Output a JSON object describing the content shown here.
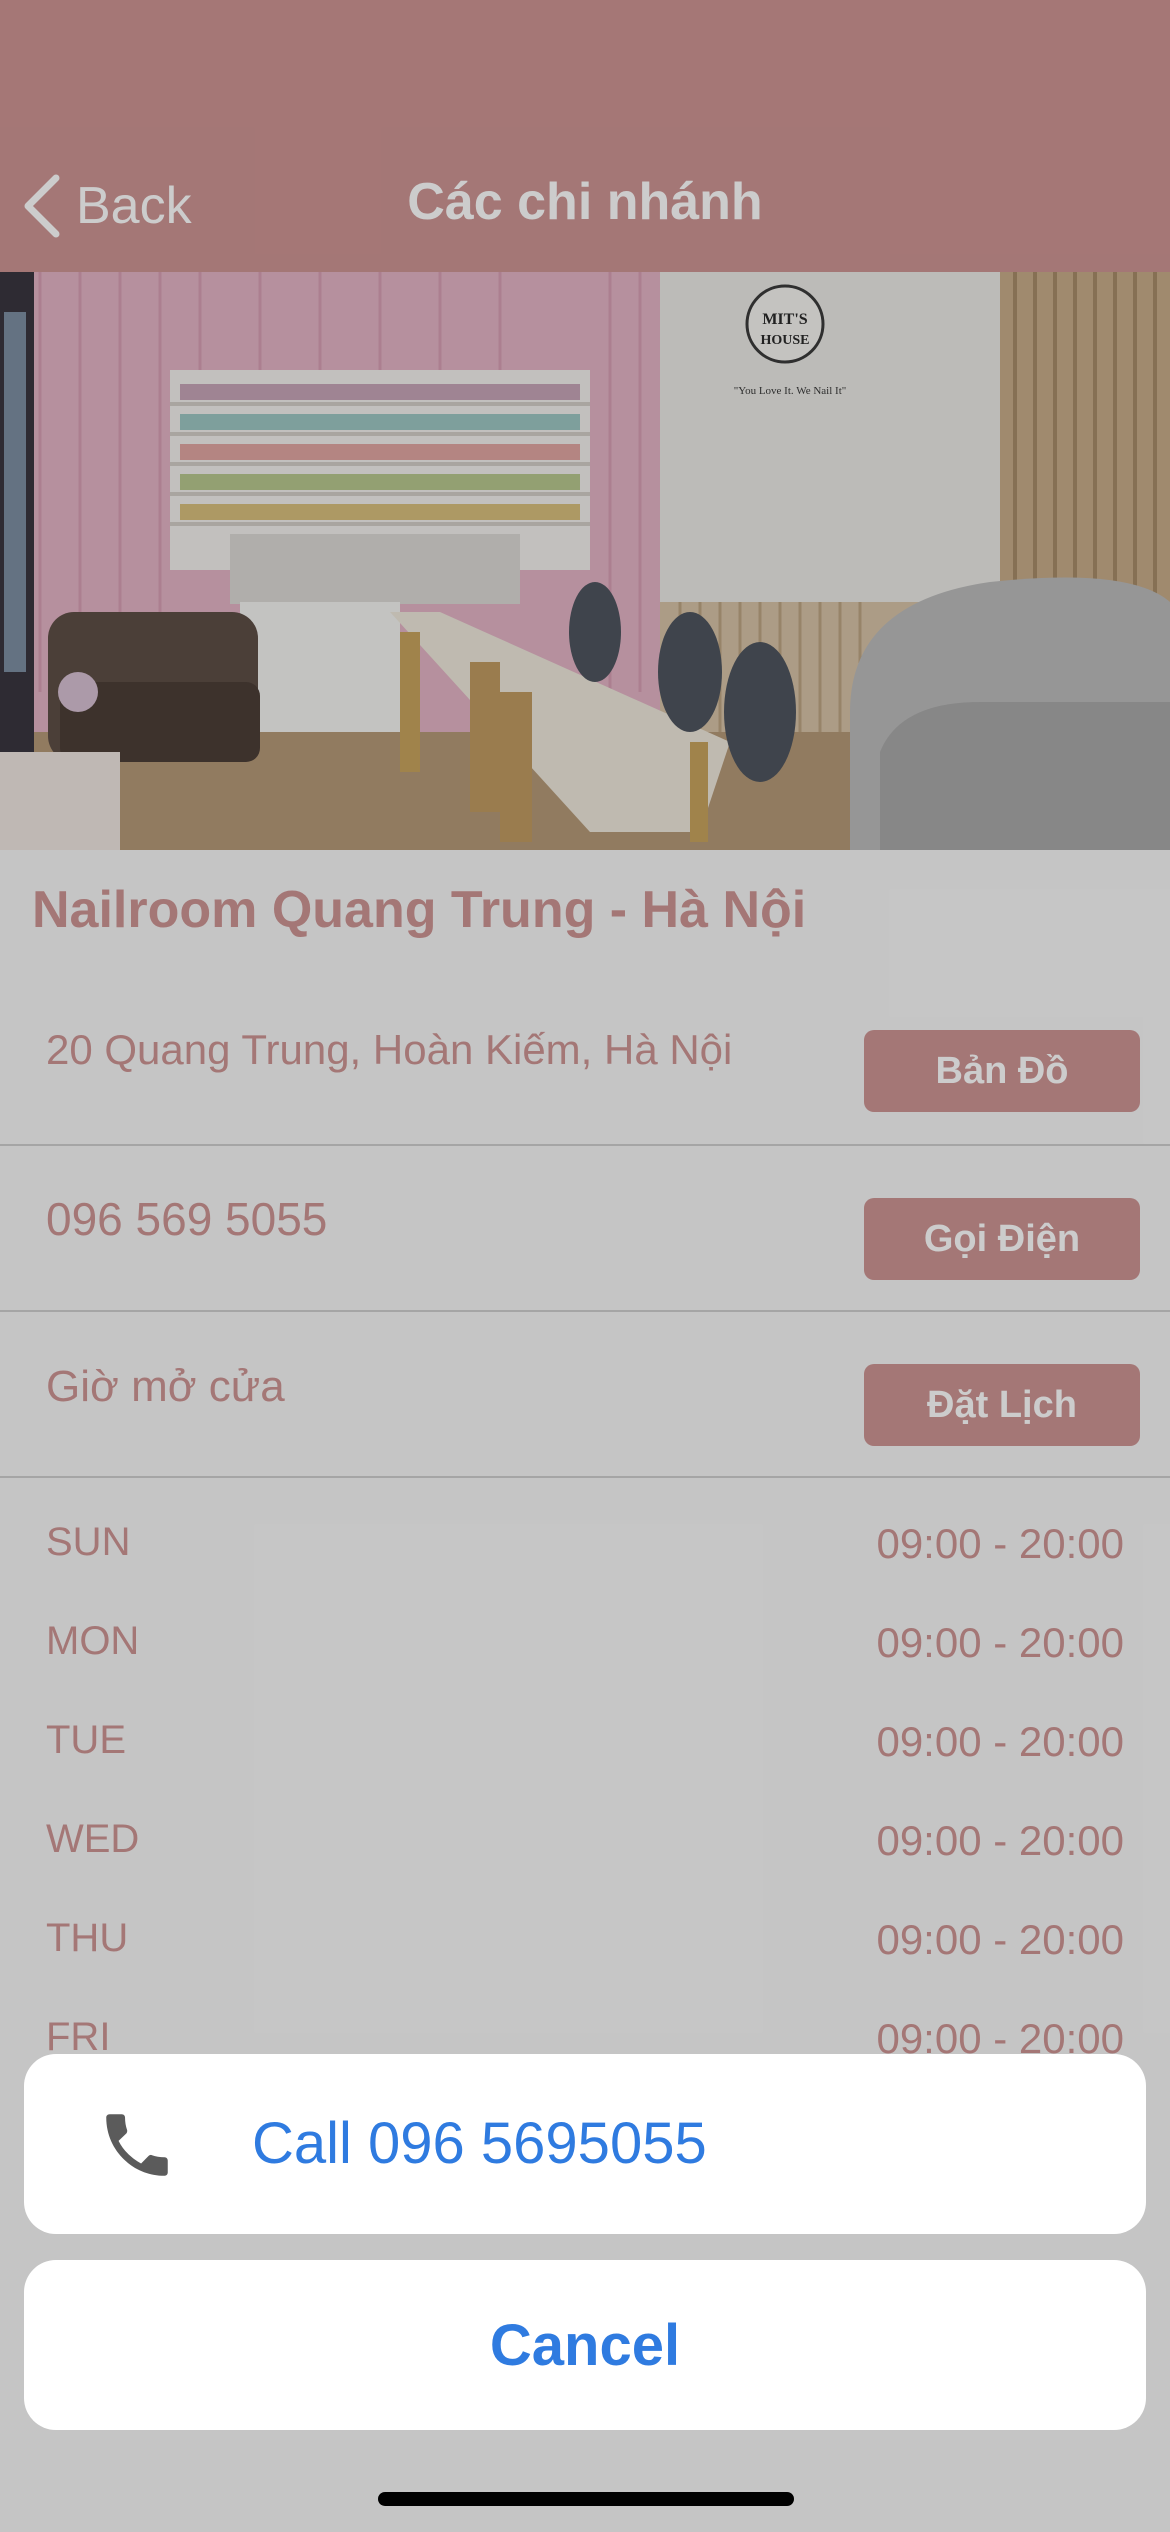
{
  "header": {
    "back_label": "Back",
    "title": "Các chi nhánh"
  },
  "branch": {
    "name": "Nailroom Quang Trung - Hà Nội",
    "address": "20 Quang Trung, Hoàn Kiếm, Hà Nội",
    "map_button": "Bản Đồ",
    "phone": "096 569 5055",
    "call_button": "Gọi Điện",
    "hours_label": "Giờ mở cửa",
    "book_button": "Đặt Lịch",
    "hours": [
      {
        "day": "SUN",
        "time": "09:00 - 20:00"
      },
      {
        "day": "MON",
        "time": "09:00 - 20:00"
      },
      {
        "day": "TUE",
        "time": "09:00 - 20:00"
      },
      {
        "day": "WED",
        "time": "09:00 - 20:00"
      },
      {
        "day": "THU",
        "time": "09:00 - 20:00"
      },
      {
        "day": "FRI",
        "time": "09:00 - 20:00"
      }
    ]
  },
  "photo": {
    "logo_line1": "MIT'S",
    "logo_line2": "HOUSE",
    "slogan": "\"You Love It. We Nail It\""
  },
  "action_sheet": {
    "call_label": "Call 096 5695055",
    "cancel_label": "Cancel"
  },
  "colors": {
    "brand": "#ce9594",
    "action_blue": "#2f7be0"
  }
}
